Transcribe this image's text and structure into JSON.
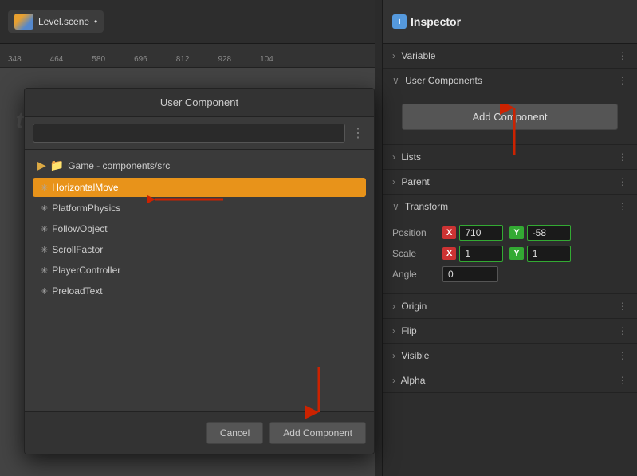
{
  "scene": {
    "title": "Level.scene",
    "modified": true,
    "ruler_marks": [
      "348",
      "464",
      "580",
      "696",
      "812",
      "928",
      "104..."
    ],
    "text_label": "text"
  },
  "dialog": {
    "title": "User Component",
    "search_placeholder": "",
    "tree": {
      "folder_name": "Game",
      "folder_path": "components/src",
      "items": [
        {
          "label": "HorizontalMove",
          "selected": true
        },
        {
          "label": "PlatformPhysics",
          "selected": false
        },
        {
          "label": "FollowObject",
          "selected": false
        },
        {
          "label": "ScrollFactor",
          "selected": false
        },
        {
          "label": "PlayerController",
          "selected": false
        },
        {
          "label": "PreloadText",
          "selected": false
        }
      ]
    },
    "cancel_label": "Cancel",
    "add_label": "Add Component"
  },
  "inspector": {
    "title": "Inspector",
    "icon_label": "i",
    "sections": [
      {
        "label": "Variable",
        "expanded": false
      },
      {
        "label": "User Components",
        "expanded": true
      },
      {
        "label": "Lists",
        "expanded": false
      },
      {
        "label": "Parent",
        "expanded": false
      },
      {
        "label": "Transform",
        "expanded": true
      },
      {
        "label": "Origin",
        "expanded": false
      },
      {
        "label": "Flip",
        "expanded": false
      },
      {
        "label": "Visible",
        "expanded": false
      },
      {
        "label": "Alpha",
        "expanded": false
      }
    ],
    "add_component_label": "Add Component",
    "transform": {
      "position_label": "Position",
      "scale_label": "Scale",
      "angle_label": "Angle",
      "pos_x": "710",
      "pos_y": "-58",
      "scale_x": "1",
      "scale_y": "1",
      "angle": "0"
    }
  }
}
